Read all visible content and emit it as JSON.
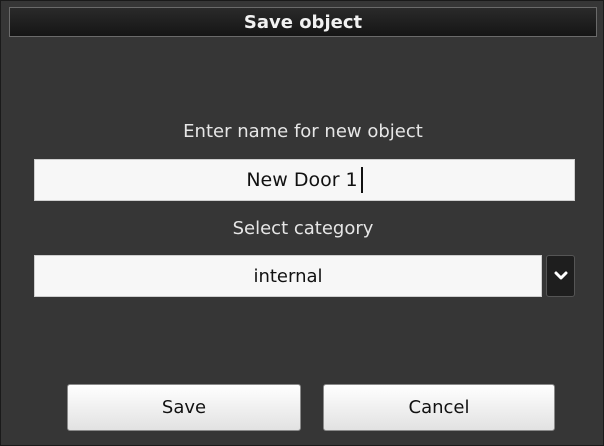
{
  "dialog": {
    "title": "Save object",
    "name_label": "Enter name for new object",
    "name_value": "New Door 1",
    "category_label": "Select category",
    "category_value": "internal",
    "dropdown_icon": "chevron-down-icon",
    "save_label": "Save",
    "cancel_label": "Cancel"
  },
  "colors": {
    "dialog_background": "#363636",
    "titlebar_background": "#151515",
    "field_background": "#f7f7f7"
  }
}
